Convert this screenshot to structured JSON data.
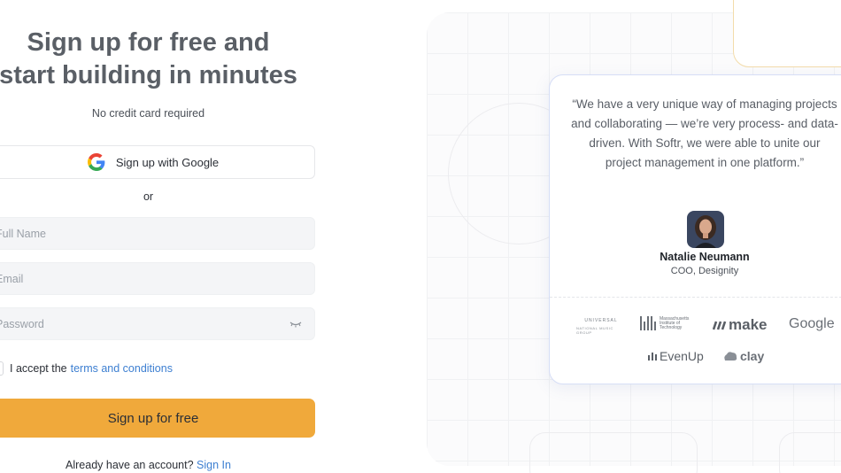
{
  "signup": {
    "title_line1": "Sign up for free and",
    "title_line2": "start building in minutes",
    "subtitle": "No credit card required",
    "google_button": "Sign up with Google",
    "or": "or",
    "full_name_placeholder": "Full Name",
    "email_placeholder": "Email",
    "password_placeholder": "Password",
    "accept_text": "I accept the",
    "terms_link": "terms and conditions",
    "submit": "Sign up for free",
    "have_account": "Already have an account?",
    "signin_link": "Sign In"
  },
  "testimonial": {
    "quote": "“We have a very unique way of managing projects and collaborating — we’re very process- and data-driven. With Softr, we were able to unite our project management in one platform.”",
    "name": "Natalie Neumann",
    "role": "COO, Designity"
  },
  "logos": {
    "universal_line1": "UNIVERSAL",
    "universal_line2": "NATIONAL MUSIC GROUP",
    "mit": "Massachusetts Institute of Technology",
    "make": "make",
    "google": "Google",
    "evenup": "EvenUp",
    "clay": "clay"
  },
  "colors": {
    "accent": "#f0a93b",
    "link": "#3d7fd1"
  }
}
